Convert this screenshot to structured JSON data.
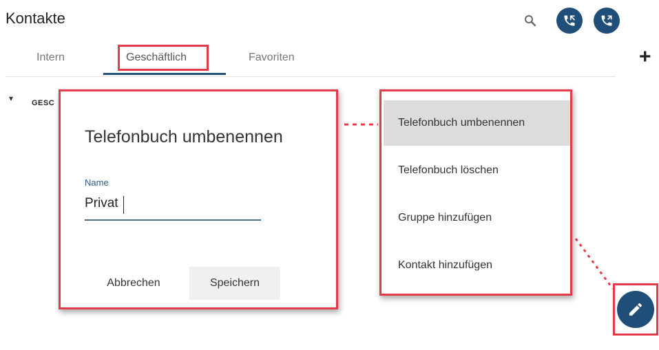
{
  "header": {
    "title": "Kontakte",
    "icons": [
      "search-icon",
      "phone-forward-icon",
      "phone-forward-icon"
    ]
  },
  "tabs": [
    {
      "label": "Intern"
    },
    {
      "label": "Geschäftlich",
      "active": true
    },
    {
      "label": "Favoriten"
    }
  ],
  "add_icon": "+",
  "tree": {
    "item_label": "GESC"
  },
  "rename_dialog": {
    "title": "Telefonbuch umbenennen",
    "field_label": "Name",
    "field_value": "Privat",
    "cancel_label": "Abbrechen",
    "save_label": "Speichern"
  },
  "context_menu": {
    "items": [
      {
        "label": "Telefonbuch umbenennen",
        "active": true
      },
      {
        "label": "Telefonbuch löschen"
      },
      {
        "label": "Gruppe hinzufügen"
      },
      {
        "label": "Kontakt hinzufügen"
      }
    ]
  },
  "fab": {
    "icon": "pencil-icon"
  },
  "colors": {
    "primary": "#1f4e79",
    "highlight": "#e53a4a",
    "menu_active_bg": "#dcdcdc"
  }
}
